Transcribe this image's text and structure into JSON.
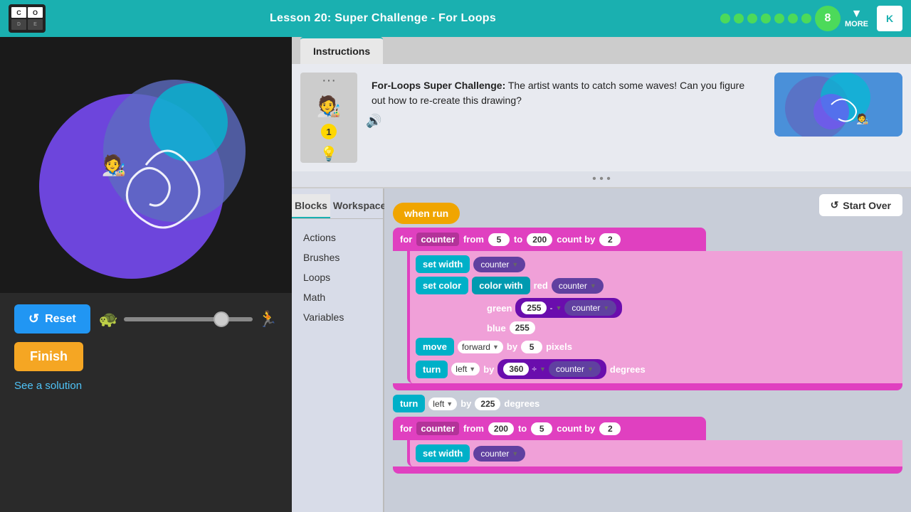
{
  "header": {
    "logo": [
      "CO",
      "DE",
      "",
      ""
    ],
    "logo_cells": [
      "C",
      "O",
      "D",
      "E"
    ],
    "title": "Lesson 20: Super Challenge - For Loops",
    "progress_count": "8",
    "more_label": "MORE",
    "k_label": "K"
  },
  "left_panel": {
    "reset_label": "Reset",
    "finish_label": "Finish",
    "see_solution_label": "See a solution"
  },
  "instructions": {
    "tab_label": "Instructions",
    "hint_number": "1",
    "challenge_title": "For-Loops Super Challenge:",
    "challenge_text": " The artist wants to catch some waves! Can you figure out how to re-create this drawing?"
  },
  "blocks_panel": {
    "blocks_tab": "Blocks",
    "workspace_tab": "Workspace",
    "categories": [
      "Actions",
      "Brushes",
      "Loops",
      "Math",
      "Variables"
    ]
  },
  "workspace": {
    "start_over_label": "Start Over",
    "when_run_label": "when run",
    "loop1": {
      "for_label": "for",
      "counter_label": "counter",
      "from_label": "from",
      "from_val": "5",
      "to_label": "to",
      "to_val": "200",
      "count_label": "count by",
      "count_val": "2"
    },
    "set_width_label": "set width",
    "counter_var": "counter",
    "set_color_label": "set color",
    "color_with_label": "color with",
    "red_label": "red",
    "counter_red": "counter",
    "green_label": "green",
    "green_val": "255",
    "minus_label": "-",
    "counter_green": "counter",
    "blue_label": "blue",
    "blue_val": "255",
    "move_label": "move",
    "forward_label": "forward",
    "by_label": "by",
    "move_val": "5",
    "pixels_label": "pixels",
    "turn_label": "turn",
    "left_label": "left",
    "divide_label": "÷",
    "turn_val": "360",
    "counter_turn": "counter",
    "degrees_label": "degrees",
    "turn2_label": "turn",
    "left2_label": "left",
    "turn2_val": "225",
    "degrees2_label": "degrees",
    "loop2": {
      "for_label": "for",
      "counter_label": "counter",
      "from_label": "from",
      "from_val": "200",
      "to_label": "to",
      "to_val": "5",
      "count_label": "count by",
      "count_val": "2"
    },
    "set_width2_label": "set width",
    "counter_var2": "counter"
  }
}
